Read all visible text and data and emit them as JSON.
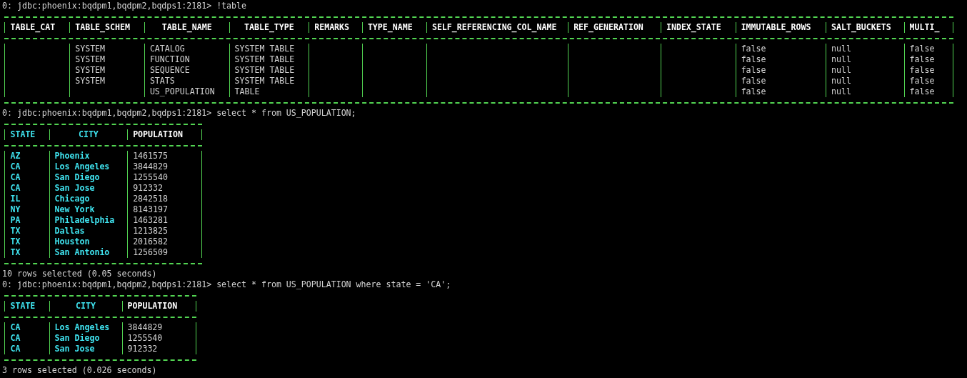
{
  "terminal": {
    "blocks": [
      {
        "kind": "prompt",
        "prompt": "0: jdbc:phoenix:bqdpm1,bqdpm2,bqdps1:2181>",
        "command": "!table"
      },
      {
        "kind": "table",
        "columns": [
          {
            "label": "TABLE_CAT",
            "highlighted": false,
            "centered": false
          },
          {
            "label": "TABLE_SCHEM",
            "highlighted": false,
            "centered": false
          },
          {
            "label": "TABLE_NAME",
            "highlighted": false,
            "centered": true
          },
          {
            "label": "TABLE_TYPE",
            "highlighted": false,
            "centered": true
          },
          {
            "label": "REMARKS",
            "highlighted": false,
            "centered": false
          },
          {
            "label": "TYPE_NAME",
            "highlighted": false,
            "centered": false
          },
          {
            "label": "SELF_REFERENCING_COL_NAME",
            "highlighted": false,
            "centered": false
          },
          {
            "label": "REF_GENERATION",
            "highlighted": false,
            "centered": false
          },
          {
            "label": "INDEX_STATE",
            "highlighted": false,
            "centered": false
          },
          {
            "label": "IMMUTABLE_ROWS",
            "highlighted": false,
            "centered": false
          },
          {
            "label": "SALT_BUCKETS",
            "highlighted": false,
            "centered": false
          },
          {
            "label": "MULTI_",
            "highlighted": false,
            "centered": false
          }
        ],
        "rows": [
          [
            null,
            "SYSTEM",
            "CATALOG",
            "SYSTEM TABLE",
            null,
            null,
            null,
            null,
            null,
            "false",
            "null",
            "false"
          ],
          [
            null,
            "SYSTEM",
            "FUNCTION",
            "SYSTEM TABLE",
            null,
            null,
            null,
            null,
            null,
            "false",
            "null",
            "false"
          ],
          [
            null,
            "SYSTEM",
            "SEQUENCE",
            "SYSTEM TABLE",
            null,
            null,
            null,
            null,
            null,
            "false",
            "null",
            "false"
          ],
          [
            null,
            "SYSTEM",
            "STATS",
            "SYSTEM TABLE",
            null,
            null,
            null,
            null,
            null,
            "false",
            "null",
            "false"
          ],
          [
            null,
            null,
            "US_POPULATION",
            "TABLE",
            null,
            null,
            null,
            null,
            null,
            "false",
            "null",
            "false"
          ]
        ]
      },
      {
        "kind": "prompt",
        "prompt": "0: jdbc:phoenix:bqdpm1,bqdpm2,bqdps1:2181>",
        "command": "select * from US_POPULATION;"
      },
      {
        "kind": "table",
        "columns": [
          {
            "label": "STATE",
            "highlighted": true,
            "centered": false
          },
          {
            "label": "CITY",
            "highlighted": true,
            "centered": true
          },
          {
            "label": "POPULATION",
            "highlighted": false,
            "centered": false
          }
        ],
        "rows": [
          [
            "AZ",
            "Phoenix",
            "1461575"
          ],
          [
            "CA",
            "Los Angeles",
            "3844829"
          ],
          [
            "CA",
            "San Diego",
            "1255540"
          ],
          [
            "CA",
            "San Jose",
            "912332"
          ],
          [
            "IL",
            "Chicago",
            "2842518"
          ],
          [
            "NY",
            "New York",
            "8143197"
          ],
          [
            "PA",
            "Philadelphia",
            "1463281"
          ],
          [
            "TX",
            "Dallas",
            "1213825"
          ],
          [
            "TX",
            "Houston",
            "2016582"
          ],
          [
            "TX",
            "San Antonio",
            "1256509"
          ]
        ]
      },
      {
        "kind": "status",
        "text": "10 rows selected (0.05 seconds)"
      },
      {
        "kind": "prompt",
        "prompt": "0: jdbc:phoenix:bqdpm1,bqdpm2,bqdps1:2181>",
        "command": "select * from US_POPULATION where state = 'CA';"
      },
      {
        "kind": "table",
        "columns": [
          {
            "label": "STATE",
            "highlighted": true,
            "centered": false
          },
          {
            "label": "CITY",
            "highlighted": true,
            "centered": true
          },
          {
            "label": "POPULATION",
            "highlighted": false,
            "centered": false
          }
        ],
        "rows": [
          [
            "CA",
            "Los Angeles",
            "3844829"
          ],
          [
            "CA",
            "San Diego",
            "1255540"
          ],
          [
            "CA",
            "San Jose",
            "912332"
          ]
        ]
      },
      {
        "kind": "status",
        "text": "3 rows selected (0.026 seconds)"
      }
    ]
  }
}
